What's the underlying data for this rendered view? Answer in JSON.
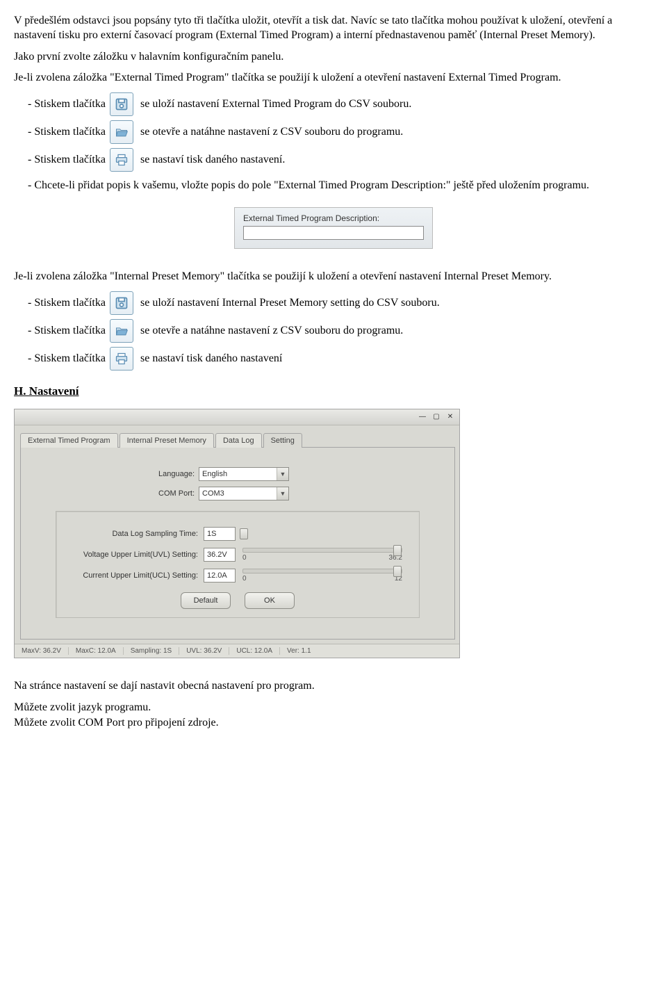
{
  "para1": "V předešlém odstavci jsou popsány tyto tři tlačítka uložit, otevřít a tisk dat. Navíc se tato tlačítka mohou používat k uložení, otevření a nastavení tisku pro externí časovací program (External Timed Program) a interní přednastavenou paměť (Internal Preset Memory).",
  "para2": "Jako první zvolte záložku v halavním konfiguračním panelu.",
  "para3": "Je-li zvolena záložka \"External Timed Program\" tlačítka se použijí k uložení a otevření nastavení External Timed Program.",
  "bullets_a": {
    "prefix": "-   Stiskem tlačítka",
    "save": "se uloží nastavení External Timed Program do CSV souboru.",
    "open": "se otevře a natáhne nastavení z CSV souboru do programu.",
    "print": "se nastaví tisk daného nastavení."
  },
  "bullet_desc": "-   Chcete-li přidat popis k vašemu, vložte popis do pole \"External Timed Program Description:\" ještě před uložením programu.",
  "desc_box_label": "External Timed Program Description:",
  "para4": "Je-li zvolena záložka \"Internal Preset Memory\" tlačítka se použijí k uložení a otevření nastavení Internal Preset Memory.",
  "bullets_b": {
    "prefix": "-   Stiskem tlačítka",
    "save": "se uloží nastavení Internal Preset Memory setting do CSV souboru.",
    "open": "se otevře a natáhne nastavení z CSV souboru do programu.",
    "print": "se nastaví tisk daného nastavení"
  },
  "heading_h": "H. Nastavení",
  "settings_window": {
    "tabs": [
      "External Timed Program",
      "Internal Preset Memory",
      "Data Log",
      "Setting"
    ],
    "active_tab_index": 3,
    "language_label": "Language:",
    "language_value": "English",
    "com_label": "COM Port:",
    "com_value": "COM3",
    "sampling_label": "Data Log Sampling Time:",
    "sampling_value": "1S",
    "uvl_label": "Voltage Upper Limit(UVL) Setting:",
    "uvl_value": "36.2V",
    "uvl_min": "0",
    "uvl_max": "36.2",
    "ucl_label": "Current Upper Limit(UCL) Setting:",
    "ucl_value": "12.0A",
    "ucl_min": "0",
    "ucl_max": "12",
    "btn_default": "Default",
    "btn_ok": "OK",
    "status": {
      "maxv": "MaxV: 36.2V",
      "maxc": "MaxC: 12.0A",
      "sampling": "Sampling: 1S",
      "uvl": "UVL: 36.2V",
      "ucl": "UCL: 12.0A",
      "ver": "Ver: 1.1"
    }
  },
  "para5": "Na stránce nastavení se dají nastavit obecná nastavení pro program.",
  "para6": "Můžete zvolit jazyk programu.",
  "para7": "Můžete zvolit COM Port pro připojení zdroje."
}
